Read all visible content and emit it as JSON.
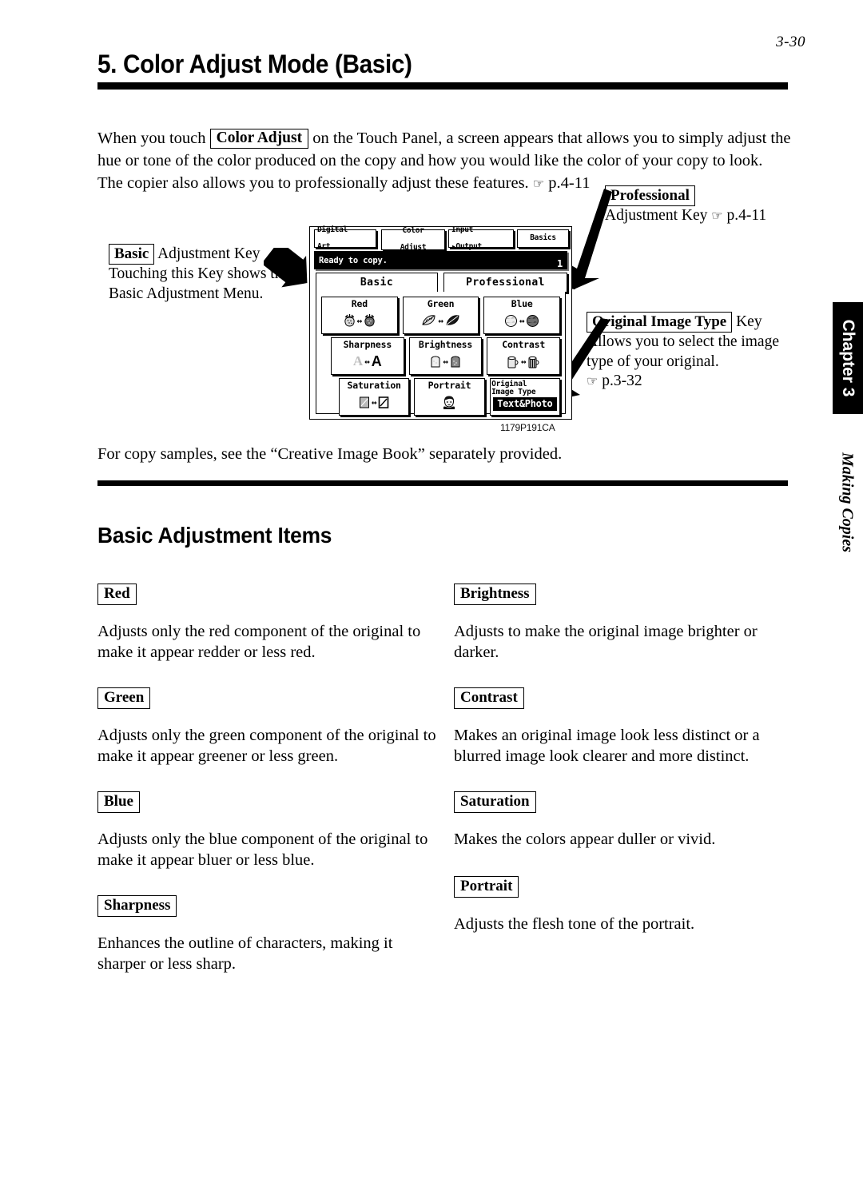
{
  "page": {
    "number": "3-30",
    "section_title": "5. Color Adjust Mode (Basic)",
    "subsection_title": "Basic Adjustment Items",
    "chapter_tab": "Chapter 3",
    "running_head": "Making Copies"
  },
  "intro": {
    "part1": "When you touch",
    "key": "Color Adjust",
    "part2": "on the Touch Panel, a screen appears that allows you to simply adjust the hue or tone of the color produced on the copy and how you would like the color of your copy to look. The copier also allows you to professionally adjust these features.",
    "hand": "☞",
    "ref": "p.4-11"
  },
  "callouts": {
    "basic": {
      "key": "Basic",
      "title_rest": "Adjustment Key",
      "body": "Touching this Key shows the Basic Adjustment Menu."
    },
    "professional": {
      "key": "Professional",
      "line2_pre": "Adjustment Key",
      "hand": "☞",
      "ref": "p.4-11"
    },
    "original_image_type": {
      "key": "Original Image Type",
      "title_rest": "Key",
      "body": "Allows you to select the image type of your original.",
      "hand": "☞",
      "ref": "p.3-32"
    }
  },
  "panel": {
    "tabs": [
      {
        "line1": "Digital",
        "line2": "Art"
      },
      {
        "line1": "Color",
        "line2": "Adjust"
      },
      {
        "line1": "Input",
        "line2": "▸Output"
      },
      {
        "line1": "Basics",
        "line2": ""
      }
    ],
    "status": {
      "message": "Ready to copy.",
      "count": "1"
    },
    "mode_tabs": [
      {
        "label": "Basic",
        "selected": true
      },
      {
        "label": "Professional",
        "selected": false
      }
    ],
    "keys": [
      {
        "label": "Red",
        "icon": "strawberry-pair"
      },
      {
        "label": "Green",
        "icon": "leaf-pair"
      },
      {
        "label": "Blue",
        "icon": "globe-pair"
      },
      {
        "label": "Sharpness",
        "icon": "letter-a-pair"
      },
      {
        "label": "Brightness",
        "icon": "bread-pair"
      },
      {
        "label": "Contrast",
        "icon": "mug-pair"
      },
      {
        "label": "Saturation",
        "icon": "card-pair"
      },
      {
        "label": "Portrait",
        "icon": "face-icon"
      },
      {
        "label_line1": "Original",
        "label_line2": "Image Type",
        "value": "Text&Photo",
        "icon": "none"
      }
    ],
    "caption": "1179P191CA"
  },
  "after_figure_text": "For copy samples, see the “Creative Image Book” separately provided.",
  "items": [
    {
      "key": "Red",
      "desc": "Adjusts only the red component of the original to make it appear redder or less red."
    },
    {
      "key": "Green",
      "desc": "Adjusts only the green component of the original to make it appear greener or less green."
    },
    {
      "key": "Blue",
      "desc": "Adjusts only the blue component of the original to make it appear bluer or less blue."
    },
    {
      "key": "Sharpness",
      "desc": "Enhances the outline of characters, making it sharper or less sharp."
    },
    {
      "key": "Brightness",
      "desc": "Adjusts to make the original image brighter or darker."
    },
    {
      "key": "Contrast",
      "desc": "Makes an original image look less distinct or a blurred image look clearer and more distinct."
    },
    {
      "key": "Saturation",
      "desc": "Makes the colors appear duller or vivid."
    },
    {
      "key": "Portrait",
      "desc": "Adjusts the flesh tone of the portrait."
    }
  ],
  "colors": {
    "ink": "#000000",
    "paper": "#ffffff",
    "panel_shadow": "#777777"
  }
}
